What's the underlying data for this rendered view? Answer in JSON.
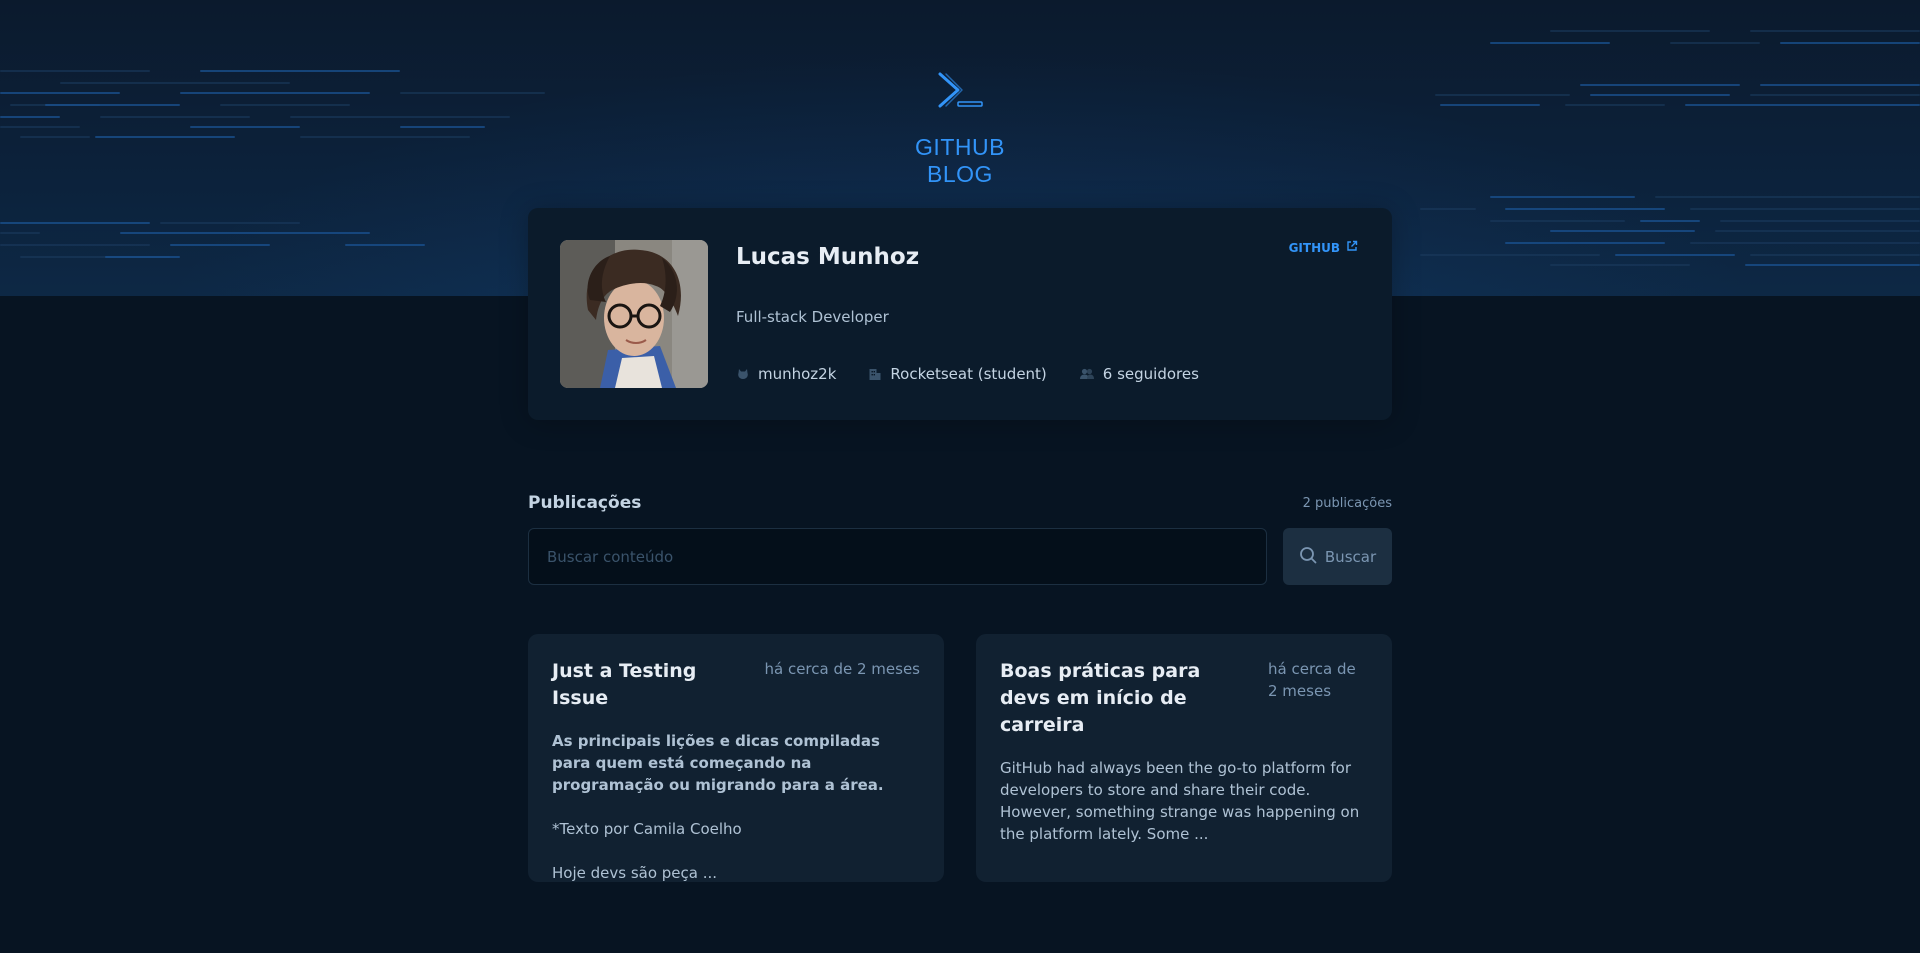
{
  "header": {
    "logo_icon": "terminal-prompt-icon",
    "title": "GITHUB BLOG",
    "accent_color": "#3294F8"
  },
  "profile": {
    "name": "Lucas Munhoz",
    "github_label": "GITHUB",
    "bio": "Full-stack Developer",
    "username": "munhoz2k",
    "company": "Rocketseat (student)",
    "followers": "6 seguidores"
  },
  "publications": {
    "title": "Publicações",
    "count": "2 publicações",
    "search_placeholder": "Buscar conteúdo",
    "search_button": "Buscar"
  },
  "posts": [
    {
      "title": "Just a Testing Issue",
      "date": "há cerca de 2 meses",
      "lead": "As principais lições e dicas compiladas para quem está começando na programação ou migrando para a área.",
      "line2": "*Texto por Camila Coelho",
      "line3": "Hoje devs são peça ..."
    },
    {
      "title": "Boas práticas para devs em início de carreira",
      "date": "há cerca de 2 meses",
      "excerpt": "GitHub had always been the go-to platform for developers to store and share their code. However, something strange was happening on the platform lately. Some  ..."
    }
  ]
}
